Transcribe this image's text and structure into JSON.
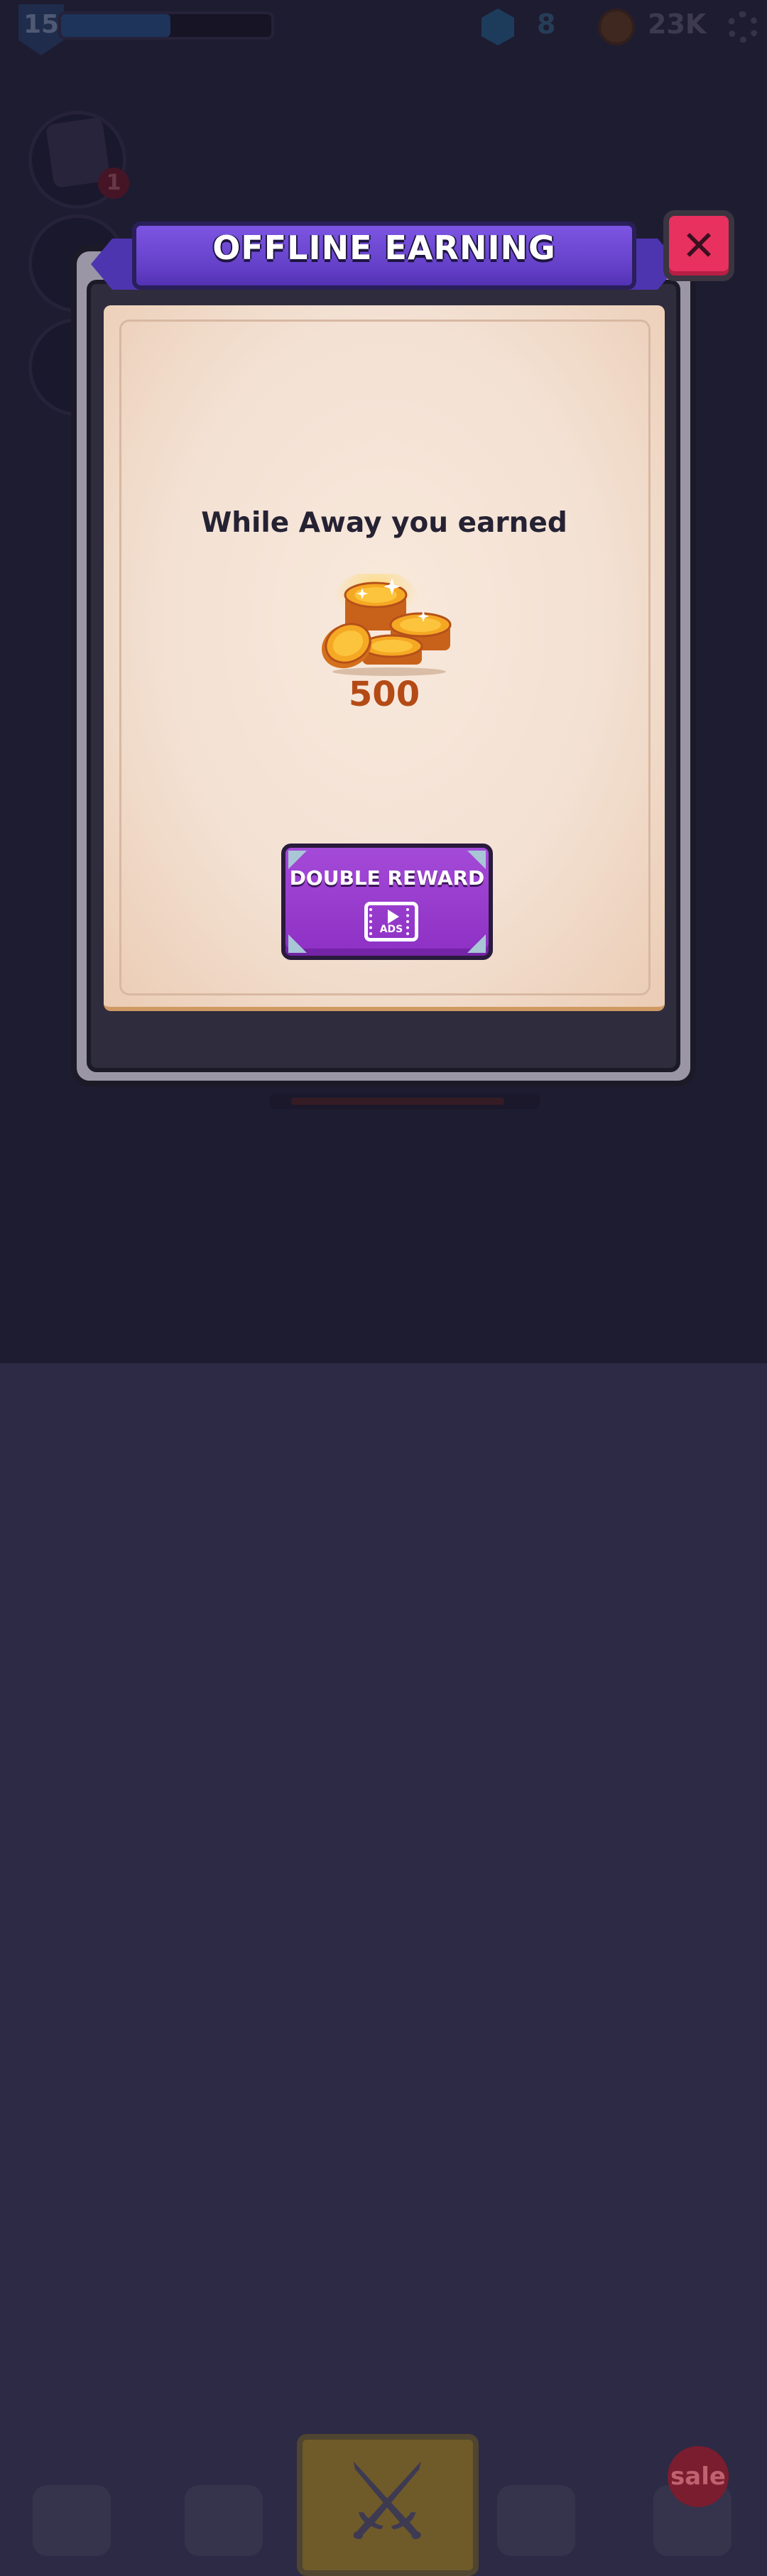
{
  "hud": {
    "level": "15",
    "xp_progress": 0.52,
    "gems": "8",
    "coins": "23K",
    "settings_icon": "gear-icon"
  },
  "side_menu": {
    "quest_badge_count": "1"
  },
  "bottom_nav": {
    "sale_label": "sale",
    "icons": [
      "anvil-icon",
      "strength-upgrade-icon",
      "crossed-swords-icon",
      "helmet-icon",
      "shop-icon"
    ]
  },
  "modal": {
    "title": "OFFLINE EARNING",
    "message": "While Away you earned",
    "reward_amount": "500",
    "reward_icon": "coin-pile-icon",
    "double_button_label": "DOUBLE REWARD",
    "ads_label": "ADS",
    "close_icon": "close-icon"
  },
  "colors": {
    "banner_purple": "#6440c8",
    "close_red": "#e8315f",
    "button_purple": "#9a3ace",
    "amount_orange": "#b44a16",
    "parchment": "#f3e1d3"
  }
}
